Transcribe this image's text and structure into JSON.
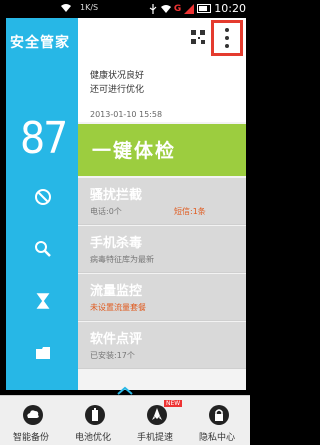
{
  "status_bar": {
    "speed": "1K/S",
    "time": "10:20"
  },
  "app": {
    "title": "安全管家"
  },
  "score": "87",
  "health": {
    "line1": "健康状况良好",
    "line2": "还可进行优化",
    "date": "2013-01-10 15:58"
  },
  "check_button": "一键体检",
  "cards": [
    {
      "title": "骚扰拦截",
      "sub": "电话:0个",
      "sub2": "短信:1条"
    },
    {
      "title": "手机杀毒",
      "sub": "病毒特征库为最新"
    },
    {
      "title": "流量监控",
      "sub": "未设置流量套餐"
    },
    {
      "title": "软件点评",
      "sub": "已安装:17个"
    }
  ],
  "bottom_tabs": [
    {
      "label": "智能备份"
    },
    {
      "label": "电池优化"
    },
    {
      "label": "手机提速",
      "badge": "NEW"
    },
    {
      "label": "隐私中心"
    }
  ]
}
